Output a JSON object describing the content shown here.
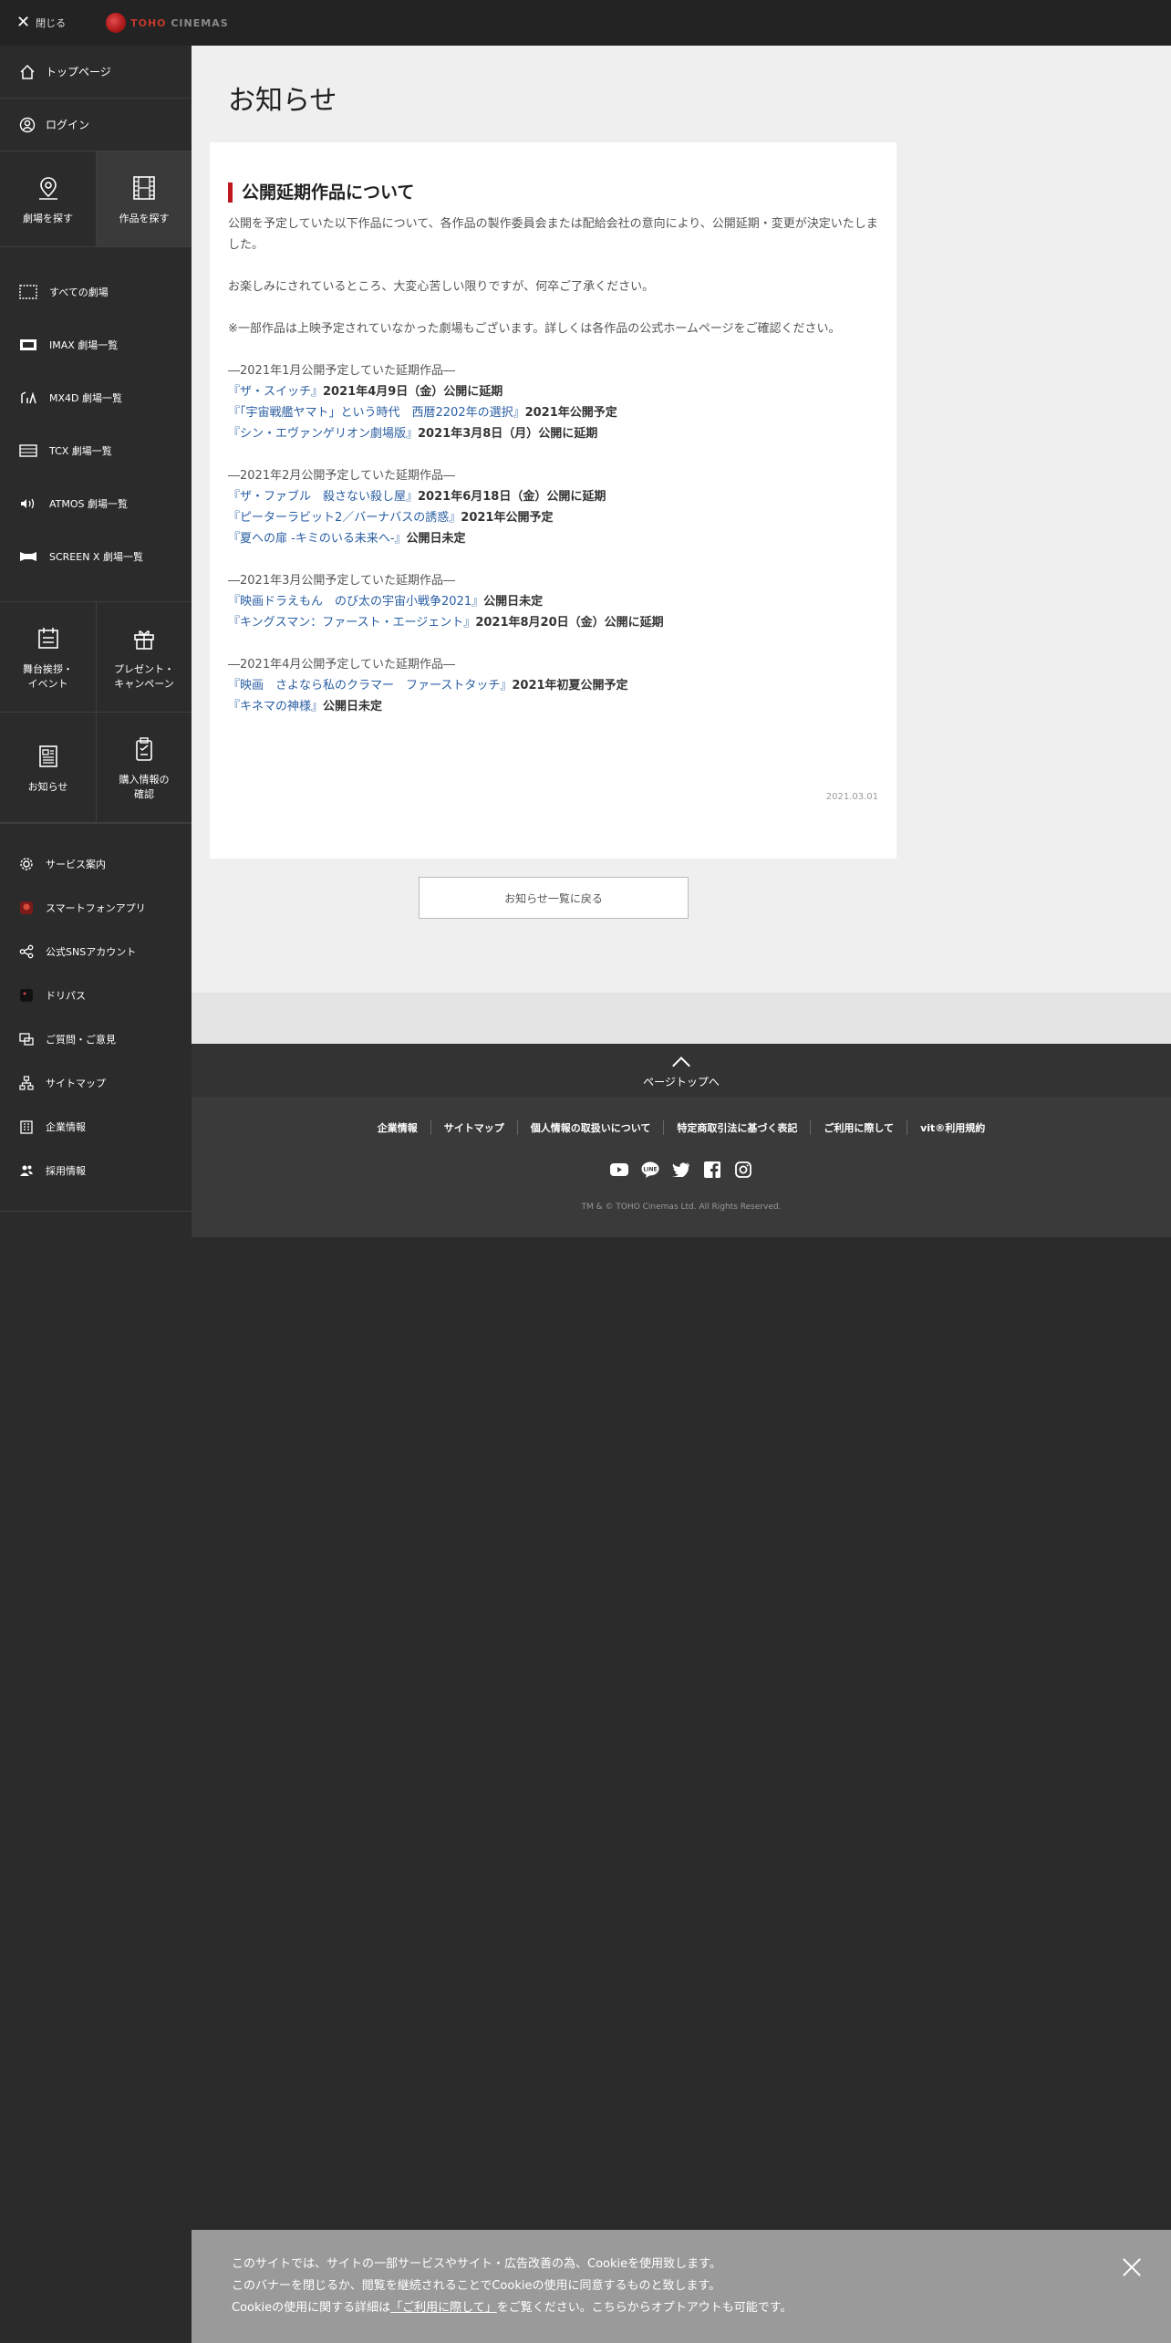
{
  "topbar": {
    "close_label": "閉じる",
    "logo_text_red": "TOHO",
    "logo_text_grey": " CINEMAS"
  },
  "sidebar": {
    "top_items": [
      {
        "label": "トップページ",
        "icon": "home-icon"
      },
      {
        "label": "ログイン",
        "icon": "user-icon"
      }
    ],
    "search_tabs": [
      {
        "label": "劇場を探す",
        "icon": "map-pin-icon"
      },
      {
        "label": "作品を探す",
        "icon": "film-icon"
      }
    ],
    "theaters": [
      {
        "label": "すべての劇場"
      },
      {
        "label": "IMAX 劇場一覧"
      },
      {
        "label": "MX4D 劇場一覧"
      },
      {
        "label": "TCX 劇場一覧"
      },
      {
        "label": "ATMOS 劇場一覧"
      },
      {
        "label": "SCREEN X 劇場一覧"
      }
    ],
    "grid_a": [
      {
        "label": "舞台挨拶・\nイベント"
      },
      {
        "label": "プレゼント・\nキャンペーン"
      }
    ],
    "grid_b": [
      {
        "label": "お知らせ"
      },
      {
        "label": "購入情報の\n確認"
      }
    ],
    "services": [
      {
        "label": "サービス案内"
      },
      {
        "label": "スマートフォンアプリ"
      },
      {
        "label": "公式SNSアカウント"
      },
      {
        "label": "ドリパス"
      },
      {
        "label": "ご質問・ご意見"
      },
      {
        "label": "サイトマップ"
      },
      {
        "label": "企業情報"
      },
      {
        "label": "採用情報"
      }
    ]
  },
  "main": {
    "page_title": "お知らせ",
    "article": {
      "title": "公開延期作品について",
      "para1": "公開を予定していた以下作品について、各作品の製作委員会または配給会社の意向により、公開延期・変更が決定いたしました。",
      "para2": "お楽しみにされているところ、大変心苦しい限りですが、何卒ご了承ください。",
      "para3": "※一部作品は上映予定されていなかった劇場もございます。詳しくは各作品の公式ホームページをご確認ください。",
      "sections": [
        {
          "head": "―2021年1月公開予定していた延期作品―",
          "lines": [
            {
              "link": "『ザ・スイッチ』",
              "note": "2021年4月9日（金）公開に延期"
            },
            {
              "link": "『「宇宙戦艦ヤマト」という時代　西暦2202年の選択』",
              "note": "2021年公開予定"
            },
            {
              "link": "『シン・エヴァンゲリオン劇場版』",
              "note": "2021年3月8日（月）公開に延期"
            }
          ]
        },
        {
          "head": "―2021年2月公開予定していた延期作品―",
          "lines": [
            {
              "link": "『ザ・ファブル　殺さない殺し屋』",
              "note": "2021年6月18日（金）公開に延期"
            },
            {
              "link": "『ピーターラビット2／バーナバスの誘惑』",
              "note": "2021年公開予定"
            },
            {
              "link": "『夏への扉 -キミのいる未来へ-』",
              "note": "公開日未定"
            }
          ]
        },
        {
          "head": "―2021年3月公開予定していた延期作品―",
          "lines": [
            {
              "link": "『映画ドラえもん　のび太の宇宙小戦争2021』",
              "note": "公開日未定"
            },
            {
              "link": "『キングスマン：ファースト・エージェント』",
              "note": "2021年8月20日（金）公開に延期"
            }
          ]
        },
        {
          "head": "―2021年4月公開予定していた延期作品―",
          "lines": [
            {
              "link": "『映画　さよなら私のクラマー　ファーストタッチ』",
              "note": "2021年初夏公開予定"
            },
            {
              "link": "『キネマの神様』",
              "note": "公開日未定"
            }
          ]
        }
      ],
      "date": "2021.03.01"
    },
    "back_button": "お知らせ一覧に戻る"
  },
  "footer": {
    "pagetop": "ページトップへ",
    "links": [
      "企業情報",
      "サイトマップ",
      "個人情報の取扱いについて",
      "特定商取引法に基づく表記",
      "ご利用に際して",
      "vit®利用規約"
    ],
    "social": [
      "youtube-icon",
      "line-icon",
      "twitter-icon",
      "facebook-icon",
      "instagram-icon"
    ],
    "copyright": "TM & © TOHO Cinemas Ltd. All Rights Reserved."
  },
  "cookie": {
    "line1": "このサイトでは、サイトの一部サービスやサイト・広告改善の為、Cookieを使用致します。",
    "line2": "このバナーを閉じるか、閲覧を継続されることでCookieの使用に同意するものと致します。",
    "line3_pre": "Cookieの使用に関する詳細は",
    "line3_link": "「ご利用に際して」",
    "line3_post": "をご覧ください。こちらからオプトアウトも可能です。"
  },
  "colors": {
    "accent_red": "#c0171e",
    "link_blue": "#2a5ea3",
    "sidebar_bg": "#2b2b2b"
  }
}
